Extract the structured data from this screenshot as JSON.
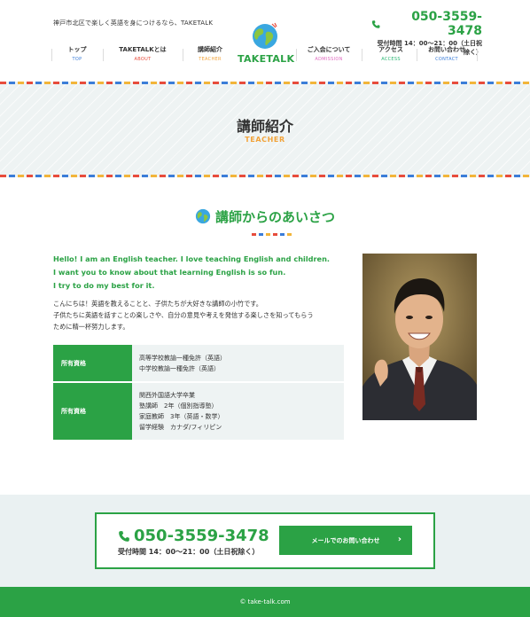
{
  "header": {
    "tagline": "神戸市北区で楽しく英語を身につけるなら、TAKETALK",
    "logo_text": "TAKETALK",
    "phone": "050-3559-3478",
    "hours": "受付時間 14：00～21：00（土日祝除く）"
  },
  "nav": [
    {
      "jp": "トップ",
      "en": "TOP",
      "color": "#3b7dd8"
    },
    {
      "jp": "TAKETALKとは",
      "en": "ABOUT",
      "color": "#e74c3c"
    },
    {
      "jp": "講師紹介",
      "en": "TEACHER",
      "color": "#f2a33a"
    },
    {
      "jp": "ご入会について",
      "en": "ADMISSION",
      "color": "#e06cc0"
    },
    {
      "jp": "アクセス",
      "en": "ACCESS",
      "color": "#2bb673"
    },
    {
      "jp": "お問い合わせ",
      "en": "CONTACT",
      "color": "#3b7dd8"
    }
  ],
  "hero": {
    "title": "講師紹介",
    "subtitle": "TEACHER"
  },
  "greeting": {
    "title": "講師からのあいさつ",
    "intro_en": [
      "Hello! I am an English teacher. I love teaching English and children.",
      "I want you to know about that learning English is so fun.",
      "I try to do my best for it."
    ],
    "intro_jp": [
      "こんにちは！英語を教えることと、子供たちが大好きな講師の小竹です。",
      "子供たちに英語を話すことの楽しさや、自分の意見や考えを発信する楽しさを知ってもらう",
      "ために精一杯努力します。"
    ]
  },
  "qualifications": [
    {
      "label": "所有資格",
      "lines": [
        "高等学校教諭一種免許（英語）",
        "中学校教諭一種免許（英語）"
      ]
    },
    {
      "label": "所有資格",
      "lines": [
        "関西外国語大学卒業",
        "塾講師　2年（個別指導塾）",
        "家庭教師　3年（英語・数学）",
        "留学経験　カナダ/フィリピン"
      ]
    }
  ],
  "contact": {
    "phone": "050-3559-3478",
    "hours": "受付時間 14：00～21：00（土日祝除く）",
    "mail_button": "メールでのお問い合わせ"
  },
  "footer": {
    "copyright": "© take-talk.com"
  },
  "colors": {
    "brand_green": "#2ba245",
    "accent_orange": "#f2a33a",
    "hero_bg": "#eef3f3"
  }
}
